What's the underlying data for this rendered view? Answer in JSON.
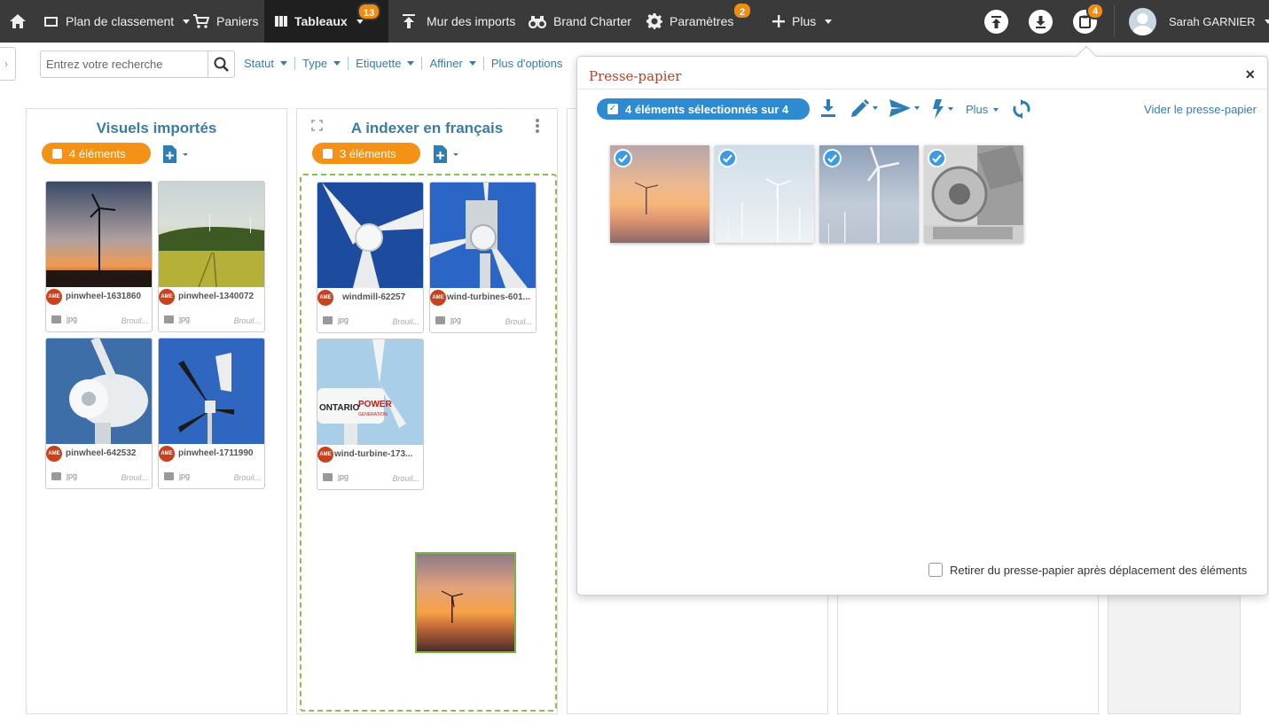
{
  "nav": {
    "items": [
      {
        "id": "plan",
        "label": "Plan de classement"
      },
      {
        "id": "paniers",
        "label": "Paniers"
      },
      {
        "id": "tableaux",
        "label": "Tableaux",
        "badge": "13"
      },
      {
        "id": "mur",
        "label": "Mur des imports"
      },
      {
        "id": "brand",
        "label": "Brand Charter"
      },
      {
        "id": "params",
        "label": "Paramètres",
        "badge": "2"
      },
      {
        "id": "plus",
        "label": "Plus"
      }
    ],
    "clipboard_badge": "4",
    "user_name": "Sarah GARNIER"
  },
  "filterbar": {
    "search_placeholder": "Entrez votre recherche",
    "filters": [
      "Statut",
      "Type",
      "Etiquette",
      "Affiner",
      "Plus d'options"
    ]
  },
  "columns": [
    {
      "title": "Visuels importés",
      "count_label": "4 éléments",
      "cards": [
        {
          "name": "pinwheel-1631860",
          "type": "jpg",
          "status": "Brouil..."
        },
        {
          "name": "pinwheel-1340072",
          "type": "jpg",
          "status": "Brouil..."
        },
        {
          "name": "pinwheel-642532",
          "type": "jpg",
          "status": "Brouil..."
        },
        {
          "name": "pinwheel-1711990",
          "type": "jpg",
          "status": "Brouil..."
        }
      ]
    },
    {
      "title": "A indexer en français",
      "count_label": "3 éléments",
      "cards": [
        {
          "name": "windmill-62257",
          "type": "jpg",
          "status": "Brouil..."
        },
        {
          "name": "wind-turbines-601...",
          "type": "jpg",
          "status": "Brouil..."
        },
        {
          "name": "wind-turbine-173...",
          "type": "jpg",
          "status": "Brouil..."
        }
      ]
    }
  ],
  "card_badge": "AME",
  "clipboard": {
    "title": "Presse-papier",
    "close": "×",
    "selection_label": "4 éléments sélectionnés sur 4",
    "more_label": "Plus",
    "empty_label": "Vider le presse-papier",
    "remove_option": "Retirer du presse-papier après déplacement des éléments",
    "items": [
      {
        "image": "sunset-turbine",
        "selected": true
      },
      {
        "image": "wind-farm-sky",
        "selected": true
      },
      {
        "image": "turbine-clouds",
        "selected": true
      },
      {
        "image": "turbine-hub-closeup",
        "selected": true
      }
    ]
  },
  "colors": {
    "nav_bg": "#3a3a3a",
    "accent_orange": "#f39216",
    "link_blue": "#2e7eb3",
    "title_blue": "#3a7ca8",
    "popup_title": "#b5422a",
    "dropzone": "#8bbf4f"
  }
}
